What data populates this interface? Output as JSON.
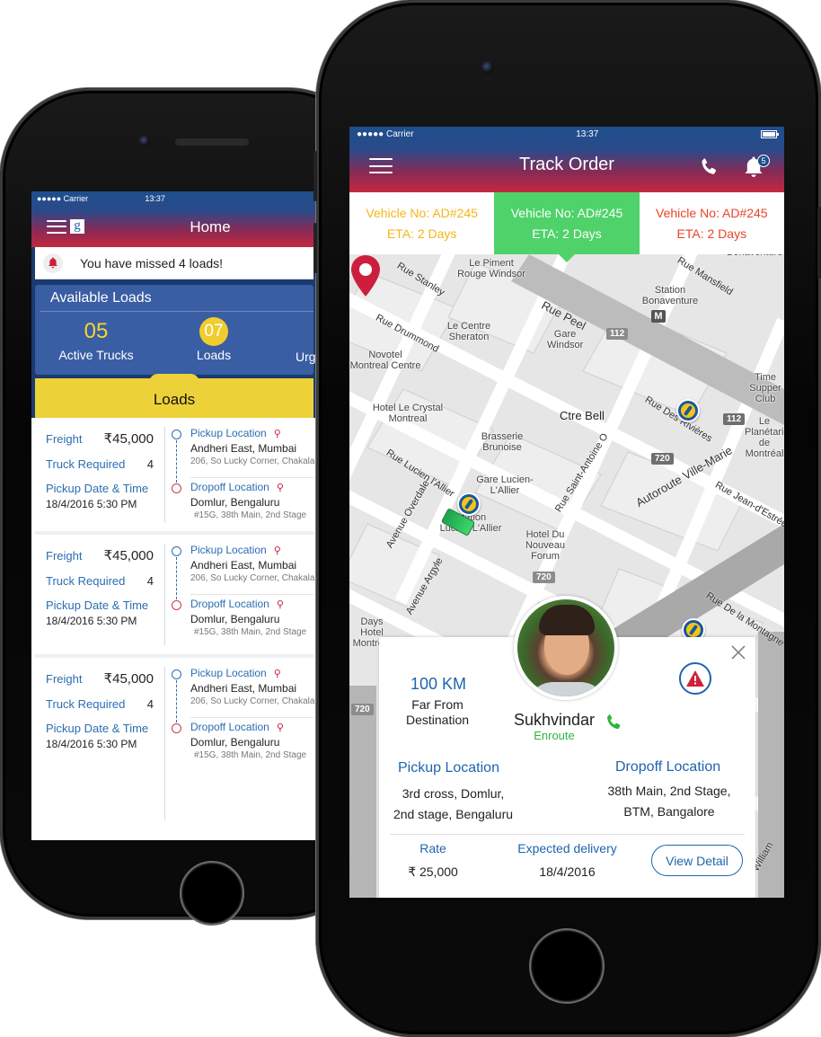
{
  "left_phone": {
    "status_bar": {
      "carrier": "●●●●● Carrier",
      "time": "13:37"
    },
    "header": {
      "title": "Home",
      "logo_letter": "g",
      "menu_icon": "hamburger-icon"
    },
    "alert": {
      "icon": "bell-icon",
      "text": "You have missed 4 loads!"
    },
    "available_loads": {
      "title": "Available Loads",
      "stats": [
        {
          "value": "05",
          "label": "Active  Trucks"
        },
        {
          "value": "07",
          "label": "Loads"
        },
        {
          "value": "",
          "label": "Urg"
        }
      ]
    },
    "loads_tab": {
      "title": "Loads"
    },
    "loads": [
      {
        "freight_label": "Freight",
        "freight_value": "₹45,000",
        "truck_label": "Truck Required",
        "truck_value": "4",
        "date_label": "Pickup Date & Time",
        "date_value": "18/4/2016 5:30 PM",
        "pickup": {
          "title": "Pickup Location",
          "main": "Andheri East, Mumbai",
          "sub": "206, So Lucky Corner, Chakala"
        },
        "dropoff": {
          "title": "Dropoff Location",
          "main": "Domlur, Bengaluru",
          "sub": "#15G, 38th Main, 2nd Stage"
        }
      },
      {
        "freight_label": "Freight",
        "freight_value": "₹45,000",
        "truck_label": "Truck Required",
        "truck_value": "4",
        "date_label": "Pickup Date & Time",
        "date_value": "18/4/2016 5:30 PM",
        "pickup": {
          "title": "Pickup Location",
          "main": "Andheri East, Mumbai",
          "sub": "206, So Lucky Corner, Chakala"
        },
        "dropoff": {
          "title": "Dropoff Location",
          "main": "Domlur, Bengaluru",
          "sub": "#15G, 38th Main, 2nd Stage"
        }
      },
      {
        "freight_label": "Freight",
        "freight_value": "₹45,000",
        "truck_label": "Truck Required",
        "truck_value": "4",
        "date_label": "Pickup Date & Time",
        "date_value": "18/4/2016 5:30 PM",
        "pickup": {
          "title": "Pickup Location",
          "main": "Andheri East, Mumbai",
          "sub": "206, So Lucky Corner, Chakala"
        },
        "dropoff": {
          "title": "Dropoff Location",
          "main": "Domlur, Bengaluru",
          "sub": "#15G, 38th Main, 2nd Stage"
        }
      }
    ]
  },
  "right_phone": {
    "status_bar": {
      "carrier": "●●●●● Carrier",
      "time": "13:37",
      "battery_level": 1.0
    },
    "header": {
      "title": "Track Order",
      "notification_count": "5"
    },
    "vehicle_tabs": [
      {
        "vehicle": "Vehicle No: AD#245",
        "eta": "ETA: 2 Days",
        "status_color": "#f5b51a"
      },
      {
        "vehicle": "Vehicle No: AD#245",
        "eta": "ETA: 2 Days",
        "status_color": "#4fd26a",
        "selected": true
      },
      {
        "vehicle": "Vehicle No: AD#245",
        "eta": "ETA: 2 Days",
        "status_color": "#e8442c"
      }
    ],
    "map": {
      "places": [
        "Le Piment Rouge Windsor",
        "Le Centre Sheraton",
        "Novotel Montreal Centre",
        "Hotel Le Crystal Montreal",
        "Brasserie Brunoise",
        "Gare Windsor",
        "Station Bonaventure",
        "Ctre Bell",
        "Gare Lucien-L'Allier",
        "Station Lucien-L'Allier",
        "Hotel Du Nouveau Forum",
        "Days Hotel Montreal",
        "Time Supper Club",
        "Le Planétarium de Montréal",
        "Bonaventure"
      ],
      "streets": [
        "Rue Stanley",
        "Rue Drummond",
        "Rue Peel",
        "Rue Mansfield",
        "Rue Saint-Antoine O",
        "Rue Lucien l'Allier",
        "Avenue Overdale",
        "Avenue Argyle",
        "Autoroute Ville-Marie",
        "Rue Jean-d'Estrées",
        "Rue De la Montagne",
        "Rue Des Rivières",
        "Rue William"
      ],
      "highways": [
        "112",
        "112",
        "720",
        "720",
        "720"
      ]
    },
    "driver_card": {
      "distance_value": "100 KM",
      "distance_label": "Far From Destination",
      "driver_name": "Sukhvindar",
      "driver_status": "Enroute",
      "pickup_title": "Pickup Location",
      "pickup_line1": "3rd cross, Domlur,",
      "pickup_line2": "2nd stage, Bengaluru",
      "dropoff_title": "Dropoff Location",
      "dropoff_line1": "38th Main, 2nd Stage,",
      "dropoff_line2": "BTM, Bangalore",
      "rate_label": "Rate",
      "rate_value": "₹ 25,000",
      "delivery_label": "Expected delivery",
      "delivery_value": "18/4/2016",
      "view_detail_label": "View Detail"
    }
  },
  "colors": {
    "brand_blue": "#1f64ad",
    "header_top": "#1e4f8c",
    "header_bottom": "#c42840",
    "loads_yellow": "#ecd139",
    "active_green": "#4fd26a",
    "status_green": "#2fb33c",
    "alert_red": "#d0354a"
  }
}
